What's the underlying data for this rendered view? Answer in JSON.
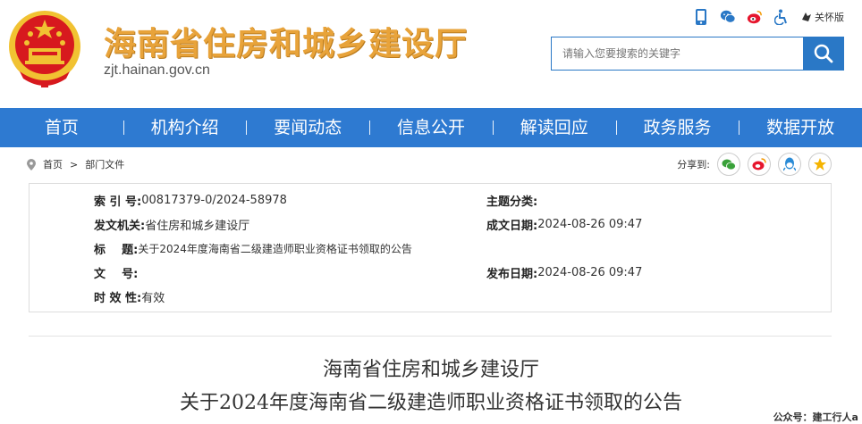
{
  "header": {
    "site_title": "海南省住房和城乡建设厅",
    "site_url": "zjt.hainan.gov.cn",
    "care_mode": "关怀版",
    "icons": [
      "mobile-icon",
      "wechat-icon",
      "weibo-icon",
      "accessibility-icon",
      "care-icon"
    ],
    "search_placeholder": "请输入您要搜索的关键字"
  },
  "nav": {
    "items": [
      "首页",
      "机构介绍",
      "要闻动态",
      "信息公开",
      "解读回应",
      "政务服务",
      "数据开放"
    ]
  },
  "breadcrumb": {
    "home": "首页",
    "separator": ">",
    "current": "部门文件"
  },
  "share": {
    "label": "分享到:",
    "targets": [
      "wechat-icon",
      "weibo-icon",
      "qq-icon",
      "qzone-icon"
    ]
  },
  "meta": {
    "index_label": "索 引 号:",
    "index_value": "00817379-0/2024-58978",
    "category_label": "主题分类:",
    "category_value": "",
    "issuer_label": "发文机关:",
    "issuer_value": "省住房和城乡建设厅",
    "created_label": "成文日期:",
    "created_value": "2024-08-26 09:47",
    "title_label": "标    题:",
    "title_value": "关于2024年度海南省二级建造师职业资格证书领取的公告",
    "docno_label": "文    号:",
    "docno_value": "",
    "published_label": "发布日期:",
    "published_value": "2024-08-26 09:47",
    "validity_label": "时 效 性:",
    "validity_value": "有效"
  },
  "document": {
    "line1": "海南省住房和城乡建设厅",
    "line2": "关于2024年度海南省二级建造师职业资格证书领取的公告"
  },
  "watermark": "公众号：建工行人a",
  "colors": {
    "nav": "#2e7ad1",
    "title": "#e8a33a",
    "search": "#2a78c6",
    "emblem_red": "#d7191e",
    "emblem_gold": "#f1c232"
  }
}
